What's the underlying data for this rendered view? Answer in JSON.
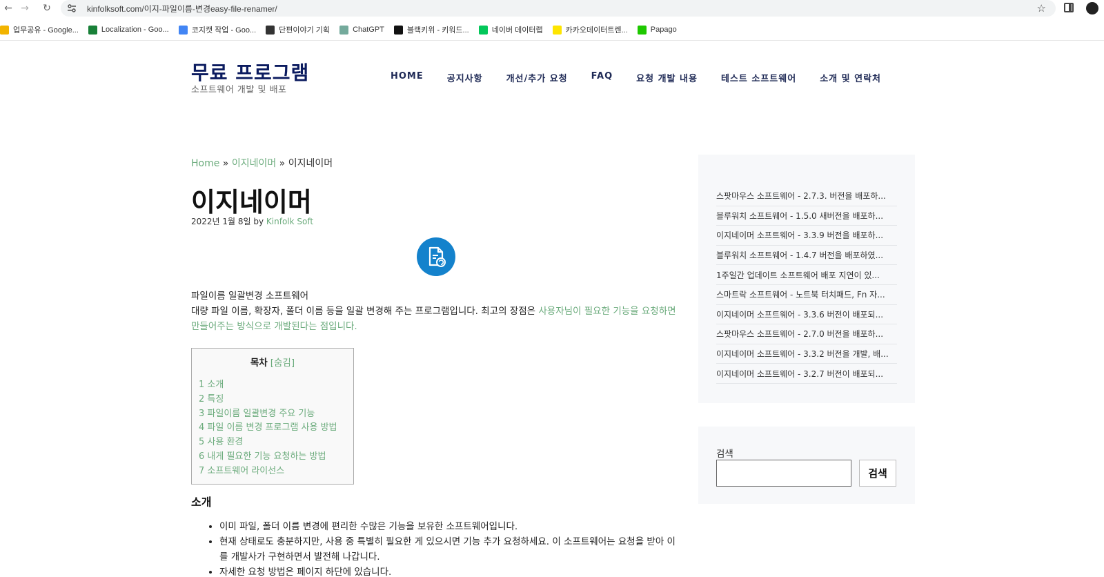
{
  "browser": {
    "url": "kinfolksoft.com/이지-파일이름-변경easy-file-renamer/",
    "bookmarks": [
      {
        "label": "업무공유 - Google...",
        "color": "#f2b400"
      },
      {
        "label": "Localization - Goo...",
        "color": "#188038"
      },
      {
        "label": "코지캣 작업 - Goo...",
        "color": "#4285f4"
      },
      {
        "label": "단편이야기 기획",
        "color": "#333333"
      },
      {
        "label": "ChatGPT",
        "color": "#74aa9c"
      },
      {
        "label": "블랙키위 - 키워드...",
        "color": "#111111"
      },
      {
        "label": "네이버 데이터랩",
        "color": "#03c75a"
      },
      {
        "label": "카카오데이터트렌...",
        "color": "#fee500"
      },
      {
        "label": "Papago",
        "color": "#1ec800"
      }
    ]
  },
  "site": {
    "title": "무료 프로그램",
    "tagline": "소프트웨어 개발 및 배포",
    "nav": [
      "HOME",
      "공지사항",
      "개선/추가 요청",
      "FAQ",
      "요청 개발 내용",
      "테스트 소프트웨어",
      "소개 및 연락처"
    ]
  },
  "breadcrumb": {
    "home": "Home",
    "sep1": " » ",
    "parent": "이지네이머",
    "sep2": " » ",
    "current": "이지네이머"
  },
  "post": {
    "title": "이지네이머",
    "date": "2022년 1월 8일 by ",
    "author": "Kinfolk Soft",
    "intro_line1": "파일이름 일괄변경 소프트웨어",
    "intro_line2": "대량 파일 이름, 확장자, 폴더 이름 등을 일괄 변경해 주는 프로그램입니다. 최고의 장점은 ",
    "intro_link": "사용자님이 필요한 기능을 요청하면 만들어주는 방식으로 개발된다는 점입니다."
  },
  "toc": {
    "heading": "목차",
    "toggle": "[숨김]",
    "items": [
      "1 소개",
      "2 특징",
      "3 파일이름 일괄변경 주요 기능",
      "4 파일 이름 변경 프로그램 사용 방법",
      "5 사용 환경",
      "6 내게 필요한 기능 요청하는 방법",
      "7 소프트웨어 라이선스"
    ]
  },
  "section": {
    "heading": "소개",
    "bullets": [
      "이미 파일, 폴더 이름 변경에 편리한 수많은 기능을 보유한 소프트웨어입니다.",
      "현재 상태로도 충분하지만, 사용 중 특별히 필요한 게 있으시면 기능 추가 요청하세요. 이 소프트웨어는 요청을 받아 이를 개발사가 구현하면서 발전해 나갑니다.",
      "자세한 요청 방법은 페이지 하단에 있습니다."
    ]
  },
  "sidebar": {
    "recent": [
      "스팟마우스 소프트웨어 - 2.7.3. 버전을 배포하...",
      "블루워치 소프트웨어 - 1.5.0 새버전을 배포하...",
      "이지네이머 소프트웨어 - 3.3.9 버전을 배포하...",
      "블루워치 소프트웨어 - 1.4.7 버전을 배포하였...",
      "1주일간 업데이트 소프트웨어 배포 지연이 있...",
      "스마트락 소프트웨어 - 노트북 터치패드, Fn 자...",
      "이지네이머 소프트웨어 - 3.3.6 버전이 배포되...",
      "스팟마우스 소프트웨어 - 2.7.0 버전을 배포하...",
      "이지네이머 소프트웨어 - 3.3.2 버전을 개발, 배...",
      "이지네이머 소프트웨어 - 3.2.7 버전이 배포되..."
    ],
    "search_label": "검색",
    "search_placeholder": "",
    "search_button": "검색"
  }
}
